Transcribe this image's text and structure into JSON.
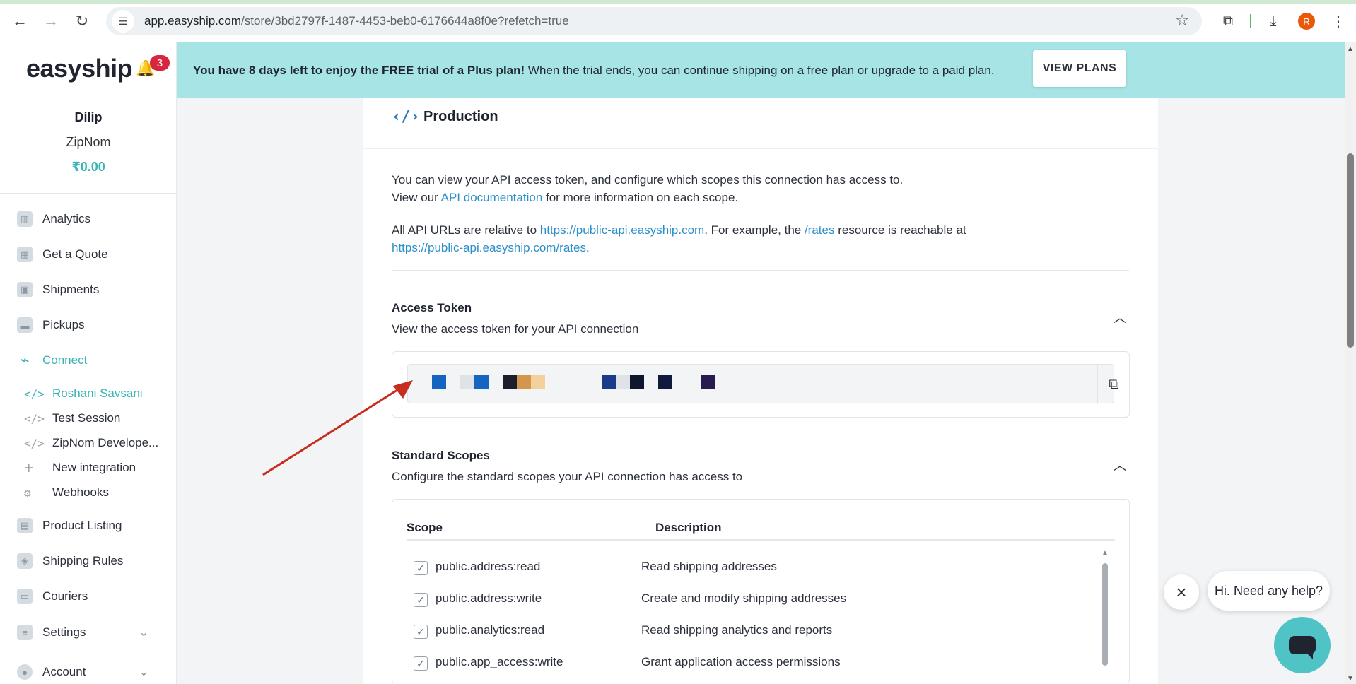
{
  "browser": {
    "url_host": "app.easyship.com",
    "url_path": "/store/3bd2797f-1487-4453-beb0-6176644a8f0e?refetch=true",
    "profile_initial": "R"
  },
  "sidebar": {
    "logo": "easyship",
    "notification_count": "3",
    "user_name": "Dilip",
    "company": "ZipNom",
    "balance": "₹0.00",
    "items": [
      {
        "label": "Analytics"
      },
      {
        "label": "Get a Quote"
      },
      {
        "label": "Shipments"
      },
      {
        "label": "Pickups"
      },
      {
        "label": "Connect"
      },
      {
        "label": "Product Listing"
      },
      {
        "label": "Shipping Rules"
      },
      {
        "label": "Couriers"
      },
      {
        "label": "Settings"
      },
      {
        "label": "Account"
      }
    ],
    "connect_sub": [
      {
        "label": "Roshani Savsani"
      },
      {
        "label": "Test Session"
      },
      {
        "label": "ZipNom Develope..."
      },
      {
        "label": "New integration"
      },
      {
        "label": "Webhooks"
      }
    ]
  },
  "banner": {
    "bold": "You have 8 days left to enjoy the FREE trial of a Plus plan!",
    "rest": " When the trial ends, you can continue shipping on a free plan or upgrade to a paid plan.",
    "button": "VIEW PLANS"
  },
  "card": {
    "title": "Production",
    "p1_line1": "You can view your API access token, and configure which scopes this connection has access to.",
    "p1_line2_a": "View our ",
    "p1_line2_link": "API documentation",
    "p1_line2_b": " for more information on each scope.",
    "p2_a": "All API URLs are relative to ",
    "p2_link1": "https://public-api.easyship.com",
    "p2_b": ". For example, the ",
    "p2_link2": "/rates",
    "p2_c": " resource is reachable at",
    "p2_link3": "https://public-api.easyship.com/rates",
    "p2_d": ".",
    "access_token": {
      "title": "Access Token",
      "subtitle": "View the access token for your API connection"
    },
    "standard_scopes": {
      "title": "Standard Scopes",
      "subtitle": "Configure the standard scopes your API connection has access to",
      "col_scope": "Scope",
      "col_description": "Description",
      "rows": [
        {
          "scope": "public.address:read",
          "description": "Read shipping addresses"
        },
        {
          "scope": "public.address:write",
          "description": "Create and modify shipping addresses"
        },
        {
          "scope": "public.analytics:read",
          "description": "Read shipping analytics and reports"
        },
        {
          "scope": "public.app_access:write",
          "description": "Grant application access permissions"
        }
      ]
    }
  },
  "chat": {
    "prompt": "Hi. Need any help?"
  },
  "colors": {
    "accent": "#39b3b5",
    "banner": "#a6e4e6",
    "link": "#2b8fc9",
    "arrow": "#c62d1f"
  }
}
